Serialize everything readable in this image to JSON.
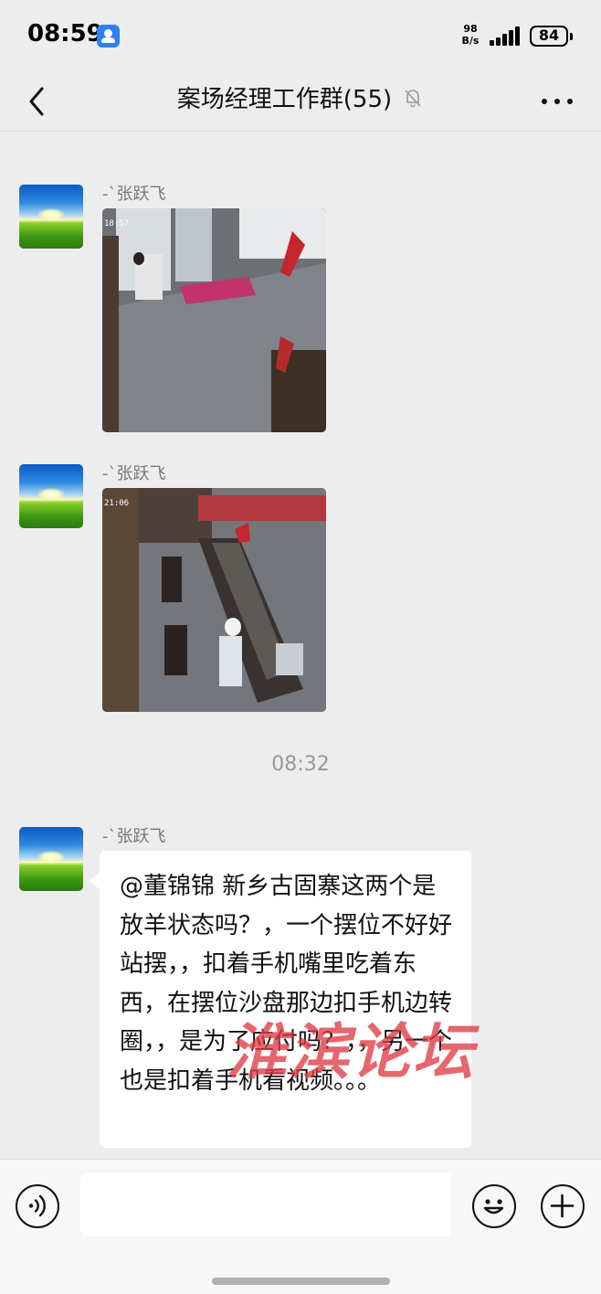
{
  "status_bar": {
    "time": "08:59",
    "net_speed_value": "98",
    "net_speed_unit": "B/s",
    "battery": "84"
  },
  "nav": {
    "title": "案场经理工作群(55)",
    "icons": {
      "back": "chevron-left-icon",
      "mute": "bell-off-icon",
      "more": "more-dots-icon"
    }
  },
  "messages": [
    {
      "type": "image",
      "sender": "-`张跃飞",
      "image_stamp": "18:57"
    },
    {
      "type": "image",
      "sender": "-`张跃飞",
      "image_stamp": "21:06"
    },
    {
      "type": "time",
      "text": "08:32"
    },
    {
      "type": "text",
      "sender": "-`张跃飞",
      "text": "@董锦锦 新乡古固寨这两个是放羊状态吗？，一个摆位不好好站摆，，扣着手机嘴里吃着东西，在摆位沙盘那边扣手机边转圈，，是为了应付吗？，，另一个也是扣着手机看视频。。。"
    }
  ],
  "watermark": "淮滨论坛",
  "input_bar": {
    "placeholder": "",
    "icons": {
      "voice": "voice-icon",
      "emoji": "emoji-icon",
      "plus": "plus-icon"
    }
  },
  "colors": {
    "background": "#ededed",
    "bubble": "#ffffff",
    "watermark": "#de3c44"
  }
}
